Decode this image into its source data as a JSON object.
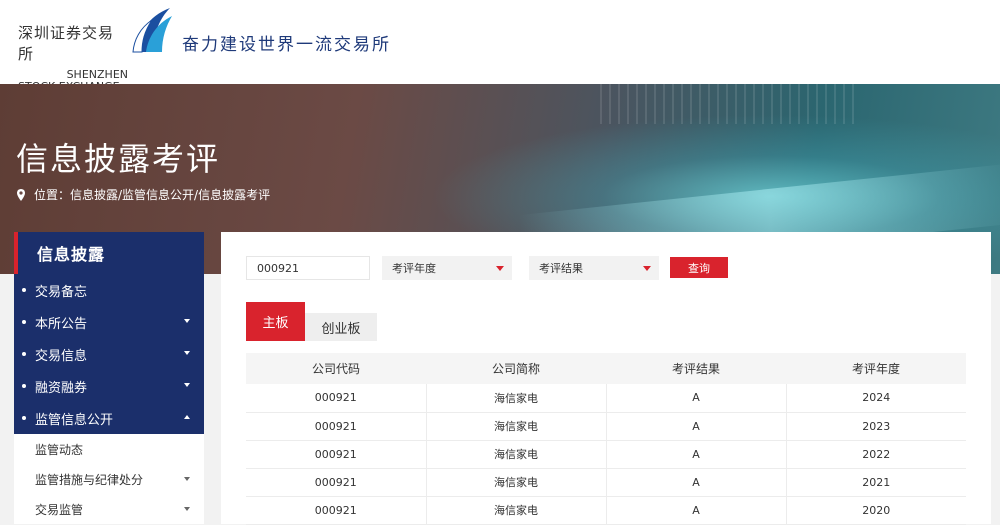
{
  "header": {
    "logo_cn": "深圳证券交易所",
    "logo_en_line1": "SHENZHEN",
    "logo_en_line2": "STOCK EXCHANGE",
    "slogan": "奋力建设世界一流交易所"
  },
  "banner": {
    "title": "信息披露考评",
    "breadcrumb": "位置：信息披露/监管信息公开/信息披露考评"
  },
  "sidebar": {
    "heading": "信息披露",
    "items": [
      {
        "label": "交易备忘",
        "caret": "none"
      },
      {
        "label": "本所公告",
        "caret": "down"
      },
      {
        "label": "交易信息",
        "caret": "down"
      },
      {
        "label": "融资融券",
        "caret": "down"
      },
      {
        "label": "监管信息公开",
        "caret": "up"
      }
    ],
    "subitems": [
      {
        "label": "监管动态",
        "caret": "none"
      },
      {
        "label": "监管措施与纪律处分",
        "caret": "down"
      },
      {
        "label": "交易监管",
        "caret": "down"
      }
    ]
  },
  "filters": {
    "code_value": "000921",
    "year_placeholder": "考评年度",
    "result_placeholder": "考评结果",
    "query_label": "查询"
  },
  "tabs": [
    "主板",
    "创业板"
  ],
  "table": {
    "headers": [
      "公司代码",
      "公司简称",
      "考评结果",
      "考评年度"
    ],
    "rows": [
      [
        "000921",
        "海信家电",
        "A",
        "2024"
      ],
      [
        "000921",
        "海信家电",
        "A",
        "2023"
      ],
      [
        "000921",
        "海信家电",
        "A",
        "2022"
      ],
      [
        "000921",
        "海信家电",
        "A",
        "2021"
      ],
      [
        "000921",
        "海信家电",
        "A",
        "2020"
      ]
    ]
  },
  "colors": {
    "accent_red": "#d9232d",
    "nav_blue": "#1b2f6b",
    "slogan_blue": "#1f3a7a"
  }
}
